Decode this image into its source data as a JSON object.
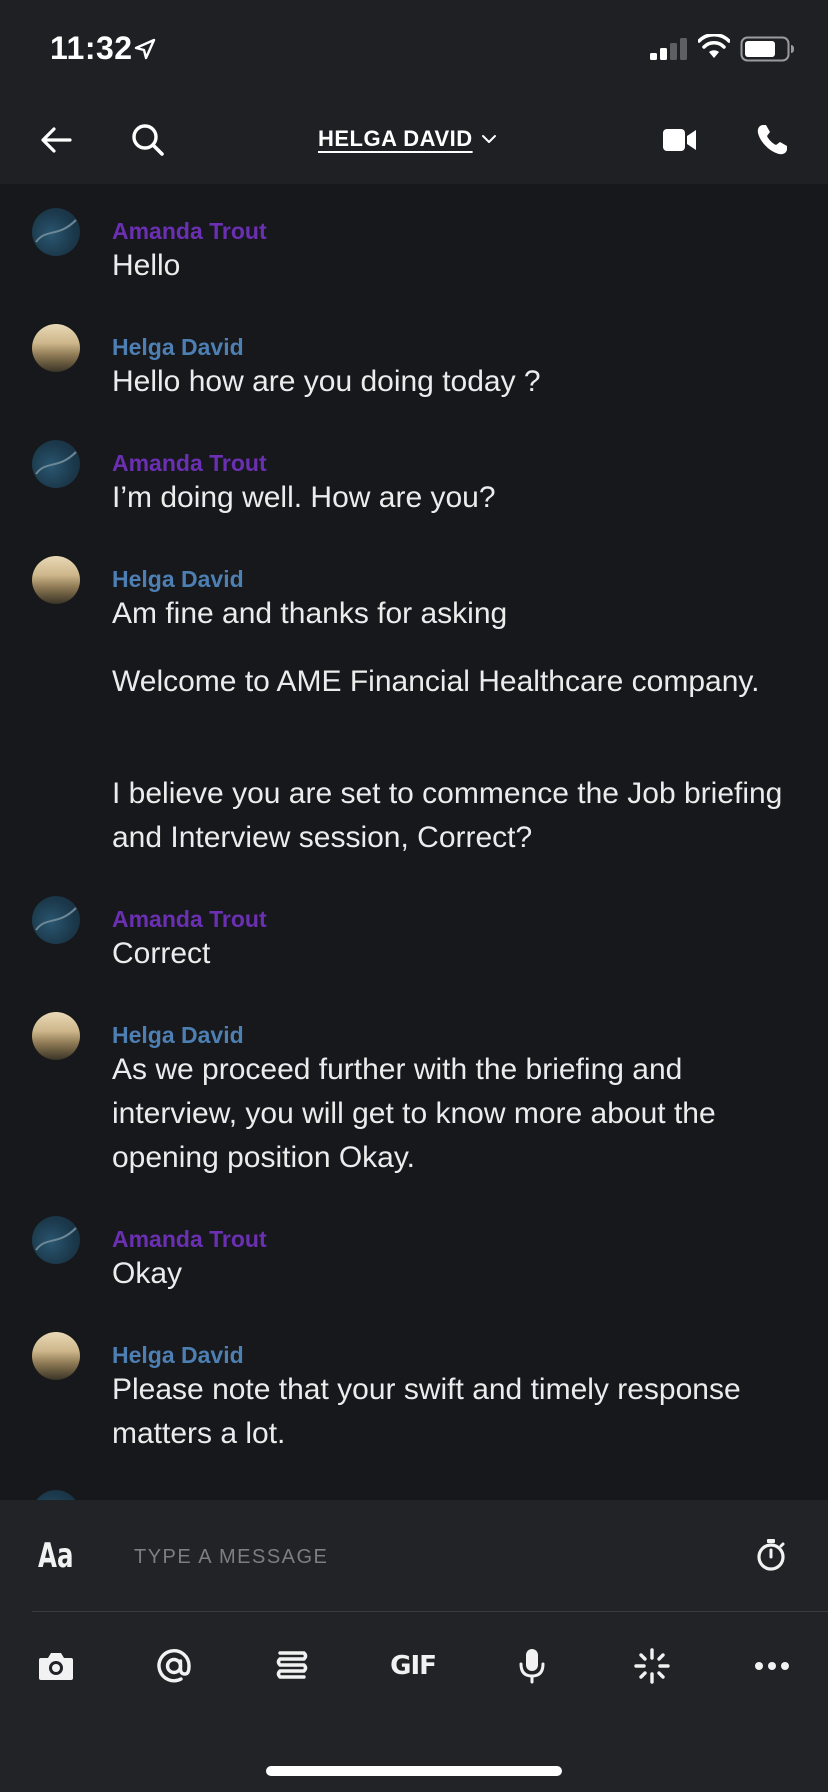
{
  "status_bar": {
    "time": "11:32"
  },
  "header": {
    "contact_name": "HELGA DAVID"
  },
  "messages": [
    {
      "sender": "Amanda Trout",
      "who": "amanda",
      "texts": [
        "Hello"
      ]
    },
    {
      "sender": "Helga David",
      "who": "helga",
      "texts": [
        "Hello how are you doing today ?"
      ]
    },
    {
      "sender": "Amanda Trout",
      "who": "amanda",
      "texts": [
        "I’m doing well. How are you?"
      ]
    },
    {
      "sender": "Helga David",
      "who": "helga",
      "texts": [
        "Am fine and thanks for asking",
        "Welcome to  AME Financial Healthcare company.",
        "I believe you are set to commence the Job briefing and Interview session, Correct?"
      ]
    },
    {
      "sender": "Amanda Trout",
      "who": "amanda",
      "texts": [
        "Correct"
      ]
    },
    {
      "sender": "Helga David",
      "who": "helga",
      "texts": [
        "As we proceed further with the briefing and interview, you will get to know more about the opening position Okay."
      ]
    },
    {
      "sender": "Amanda Trout",
      "who": "amanda",
      "texts": [
        "Okay"
      ]
    },
    {
      "sender": "Helga David",
      "who": "helga",
      "texts": [
        "Please note that your swift and timely response matters a lot."
      ]
    }
  ],
  "composer": {
    "font_toggle": "Aa",
    "placeholder": "TYPE A MESSAGE",
    "gif_label": "GIF"
  },
  "icons": {
    "back": "arrow-left-icon",
    "search": "search-icon",
    "video": "video-camera-icon",
    "call": "phone-icon",
    "timer": "stopwatch-icon",
    "camera": "camera-icon",
    "mention": "at-sign-icon",
    "stickers": "stacked-lines-icon",
    "mic": "microphone-icon",
    "sparkle": "sparkle-icon",
    "more": "more-dots-icon"
  },
  "colors": {
    "amanda": "#6a2fb3",
    "helga": "#4d7fb3",
    "background": "#17181b"
  }
}
